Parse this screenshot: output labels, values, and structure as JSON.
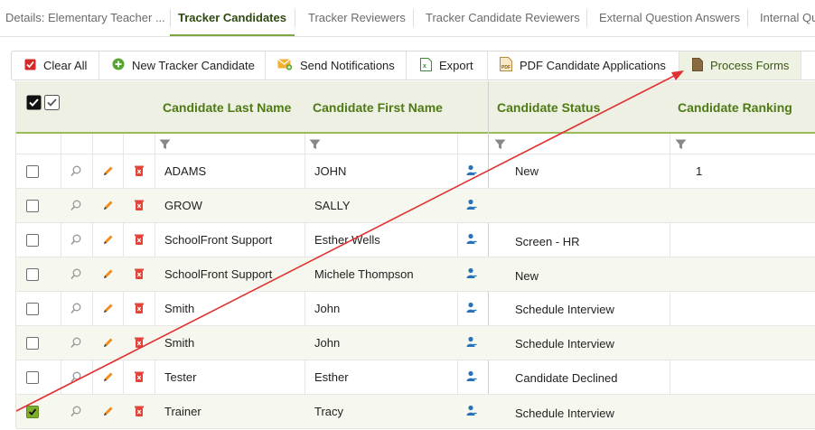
{
  "tabs": [
    {
      "label": "Details: Elementary Teacher ...",
      "active": false
    },
    {
      "label": "Tracker Candidates",
      "active": true
    },
    {
      "label": "Tracker Reviewers",
      "active": false
    },
    {
      "label": "Tracker Candidate Reviewers",
      "active": false
    },
    {
      "label": "External Question Answers",
      "active": false
    },
    {
      "label": "Internal Qu",
      "active": false
    }
  ],
  "toolbar": {
    "clear_all": "Clear All",
    "new_candidate": "New Tracker Candidate",
    "send_notifications": "Send Notifications",
    "export": "Export",
    "pdf_applications": "PDF Candidate Applications",
    "process_forms": "Process Forms"
  },
  "grid": {
    "columns": {
      "last_name": "Candidate Last Name",
      "first_name": "Candidate First Name",
      "status": "Candidate Status",
      "ranking": "Candidate Ranking"
    },
    "rows": [
      {
        "last": "ADAMS",
        "first": "JOHN",
        "status": "New",
        "ranking": "1",
        "checked": false
      },
      {
        "last": "GROW",
        "first": "SALLY",
        "status": "",
        "ranking": "",
        "checked": false
      },
      {
        "last": "SchoolFront Support",
        "first": "Esther Wells",
        "status": "Screen - HR",
        "ranking": "",
        "checked": false
      },
      {
        "last": "SchoolFront Support",
        "first": "Michele Thompson",
        "status": "New",
        "ranking": "",
        "checked": false
      },
      {
        "last": "Smith",
        "first": "John",
        "status": "Schedule Interview",
        "ranking": "",
        "checked": false
      },
      {
        "last": "Smith",
        "first": "John",
        "status": "Schedule Interview",
        "ranking": "",
        "checked": false
      },
      {
        "last": "Tester",
        "first": "Esther",
        "status": "Candidate Declined",
        "ranking": "",
        "checked": false
      },
      {
        "last": "Trainer",
        "first": "Tracy",
        "status": "Schedule Interview",
        "ranking": "",
        "checked": true
      }
    ]
  },
  "colors": {
    "accent_green": "#7ea53e",
    "header_text": "#4d7a12",
    "annotation_arrow": "#e03030"
  }
}
